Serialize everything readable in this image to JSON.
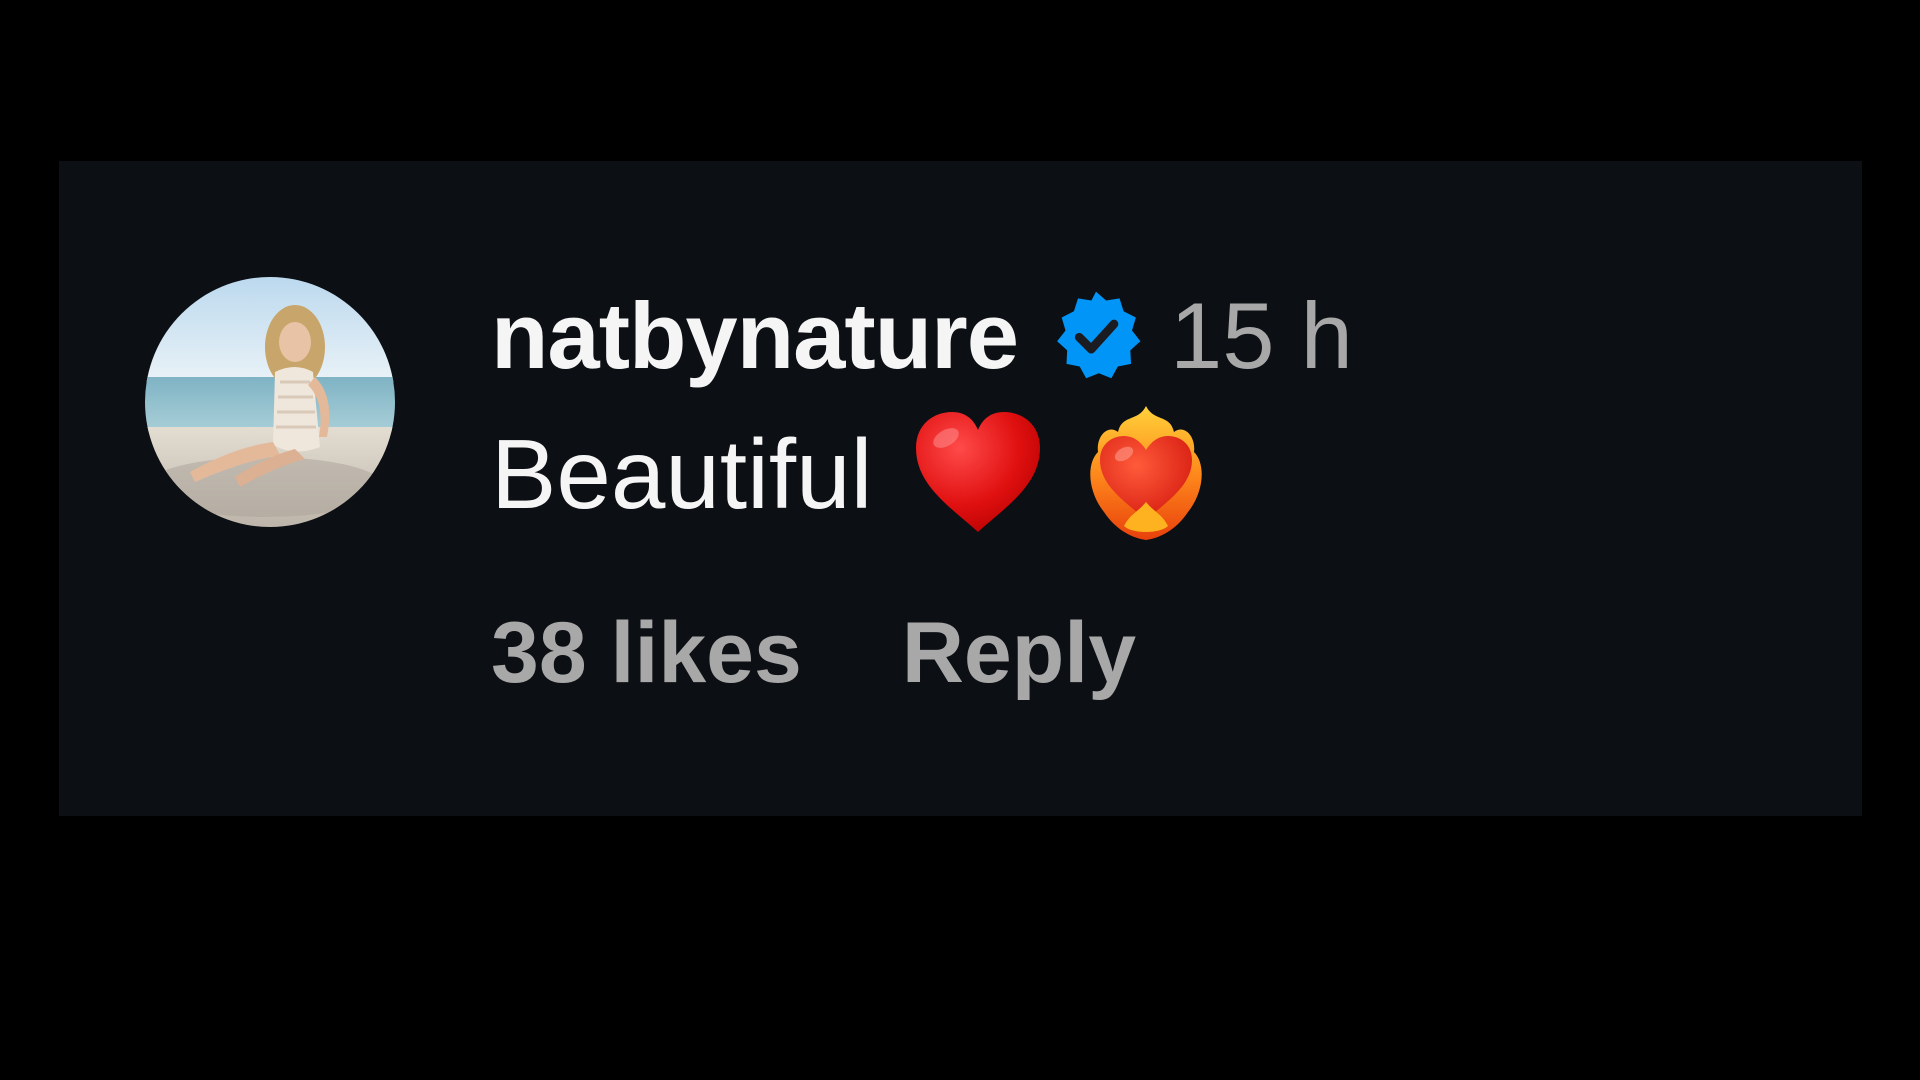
{
  "comment": {
    "username": "natbynature",
    "verified_icon": "verified-badge-icon",
    "timestamp": "15 h",
    "text": "Beautiful",
    "emojis": [
      "red-heart-icon",
      "heart-on-fire-icon"
    ],
    "likes": "38 likes",
    "reply_label": "Reply"
  },
  "colors": {
    "background": "#000000",
    "card": "#0c0f14",
    "primary_text": "#f5f5f5",
    "secondary_text": "#a8a8a8",
    "verified_blue": "#0095f6"
  }
}
